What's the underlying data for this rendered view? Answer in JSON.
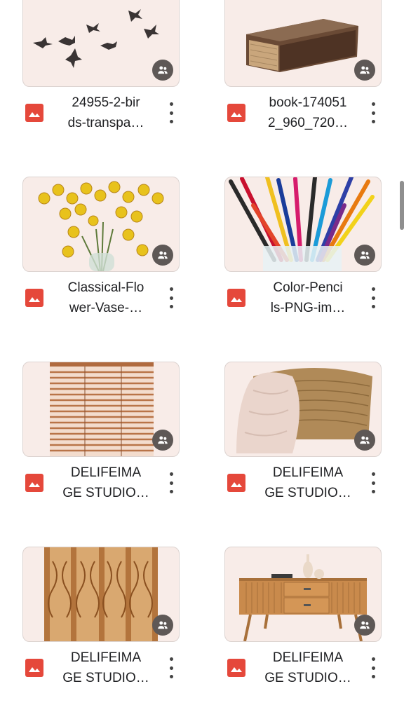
{
  "files": [
    {
      "name": "24955-2-bir\nds-transpa…",
      "image": "birds-flying",
      "shared": true
    },
    {
      "name": "book-174051\n2_960_720…",
      "image": "old-book",
      "shared": true
    },
    {
      "name": "Classical-Flo\nwer-Vase-…",
      "image": "yellow-orchid-vase",
      "shared": true
    },
    {
      "name": "Color-Penci\nls-PNG-im…",
      "image": "color-pencils-cup",
      "shared": true
    },
    {
      "name": "DELIFEIMA\nGE STUDIO…",
      "image": "wooden-blinds",
      "shared": true
    },
    {
      "name": "DELIFEIMA\nGE STUDIO…",
      "image": "wicker-basket-blanket",
      "shared": true
    },
    {
      "name": "DELIFEIMA\nGE STUDIO…",
      "image": "rattan-screen",
      "shared": true
    },
    {
      "name": "DELIFEIMA\nGE STUDIO…",
      "image": "wooden-sideboard-vases",
      "shared": true
    }
  ],
  "icons": {
    "file_type": "image-file-icon",
    "shared": "shared-people-icon",
    "menu": "more-vert-icon"
  },
  "colors": {
    "image_icon": "#e5483b",
    "thumb_bg": "#f8ece8",
    "badge": "#5e5856"
  }
}
